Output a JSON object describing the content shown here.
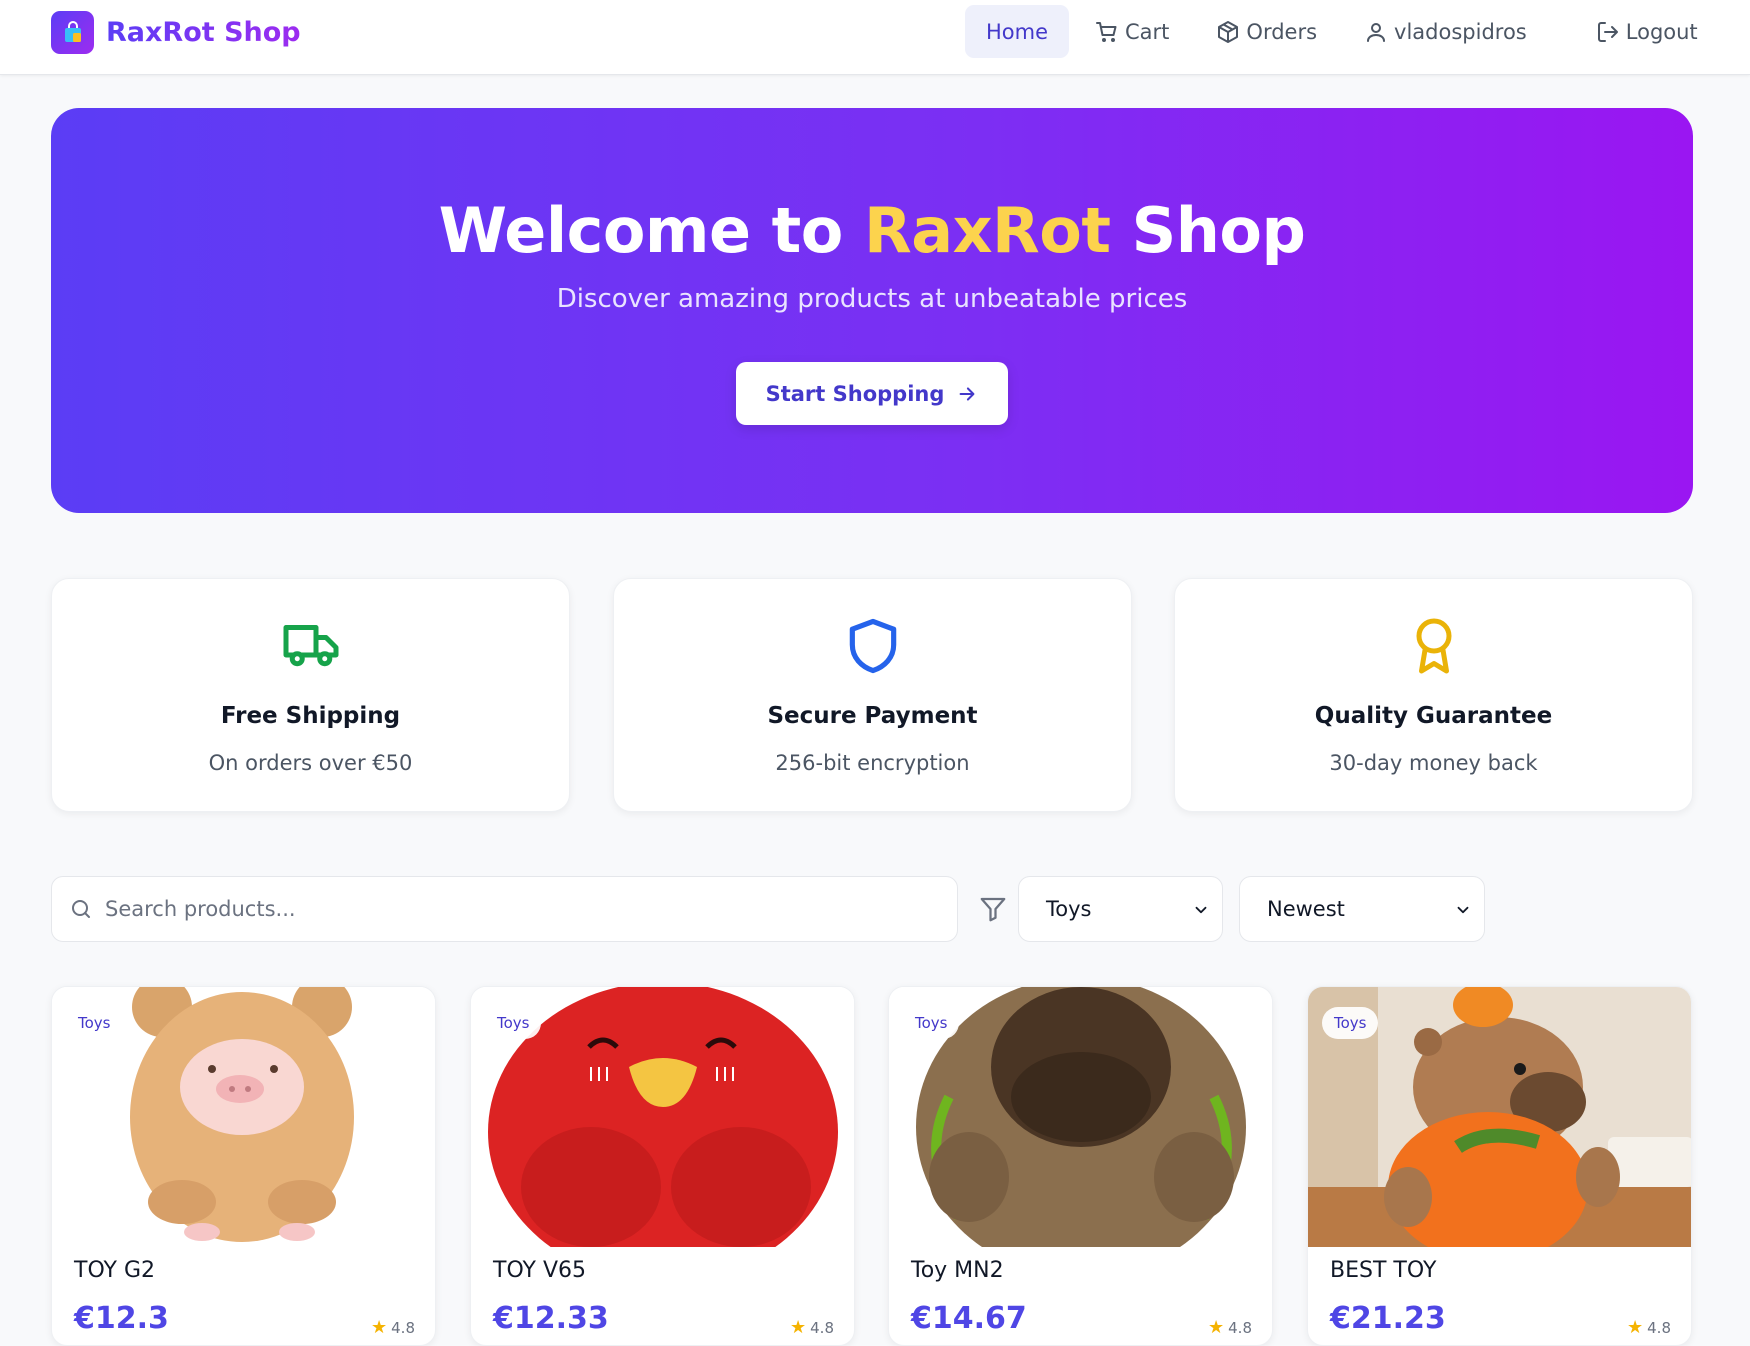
{
  "brand": {
    "name": "RaxRot Shop",
    "logo_icon": "shopping-bag-icon"
  },
  "nav": {
    "home": "Home",
    "cart": "Cart",
    "orders": "Orders",
    "user": "vladospidros",
    "logout": "Logout"
  },
  "hero": {
    "title_prefix": "Welcome to ",
    "title_accent": "RaxRot",
    "title_suffix": " Shop",
    "subtitle": "Discover amazing products at unbeatable prices",
    "button_label": "Start Shopping"
  },
  "features": [
    {
      "icon": "truck-icon",
      "title": "Free Shipping",
      "description": "On orders over €50",
      "color": "#16a34a"
    },
    {
      "icon": "shield-icon",
      "title": "Secure Payment",
      "description": "256-bit encryption",
      "color": "#2563eb"
    },
    {
      "icon": "award-icon",
      "title": "Quality Guarantee",
      "description": "30-day money back",
      "color": "#eab308"
    }
  ],
  "filters": {
    "search_placeholder": "Search products...",
    "category": "Toys",
    "sort": "Newest"
  },
  "products": [
    {
      "category": "Toys",
      "name": "TOY G2",
      "price": "€12.3",
      "rating": "4.8"
    },
    {
      "category": "Toys",
      "name": "TOY V65",
      "price": "€12.33",
      "rating": "4.8"
    },
    {
      "category": "Toys",
      "name": "Toy MN2",
      "price": "€14.67",
      "rating": "4.8"
    },
    {
      "category": "Toys",
      "name": "BEST TOY",
      "price": "€21.23",
      "rating": "4.8"
    }
  ],
  "colors": {
    "accent": "#4f46e5",
    "hero_gradient_start": "#5b3df5",
    "hero_gradient_end": "#9a16f2",
    "highlight": "#fcd34d"
  }
}
